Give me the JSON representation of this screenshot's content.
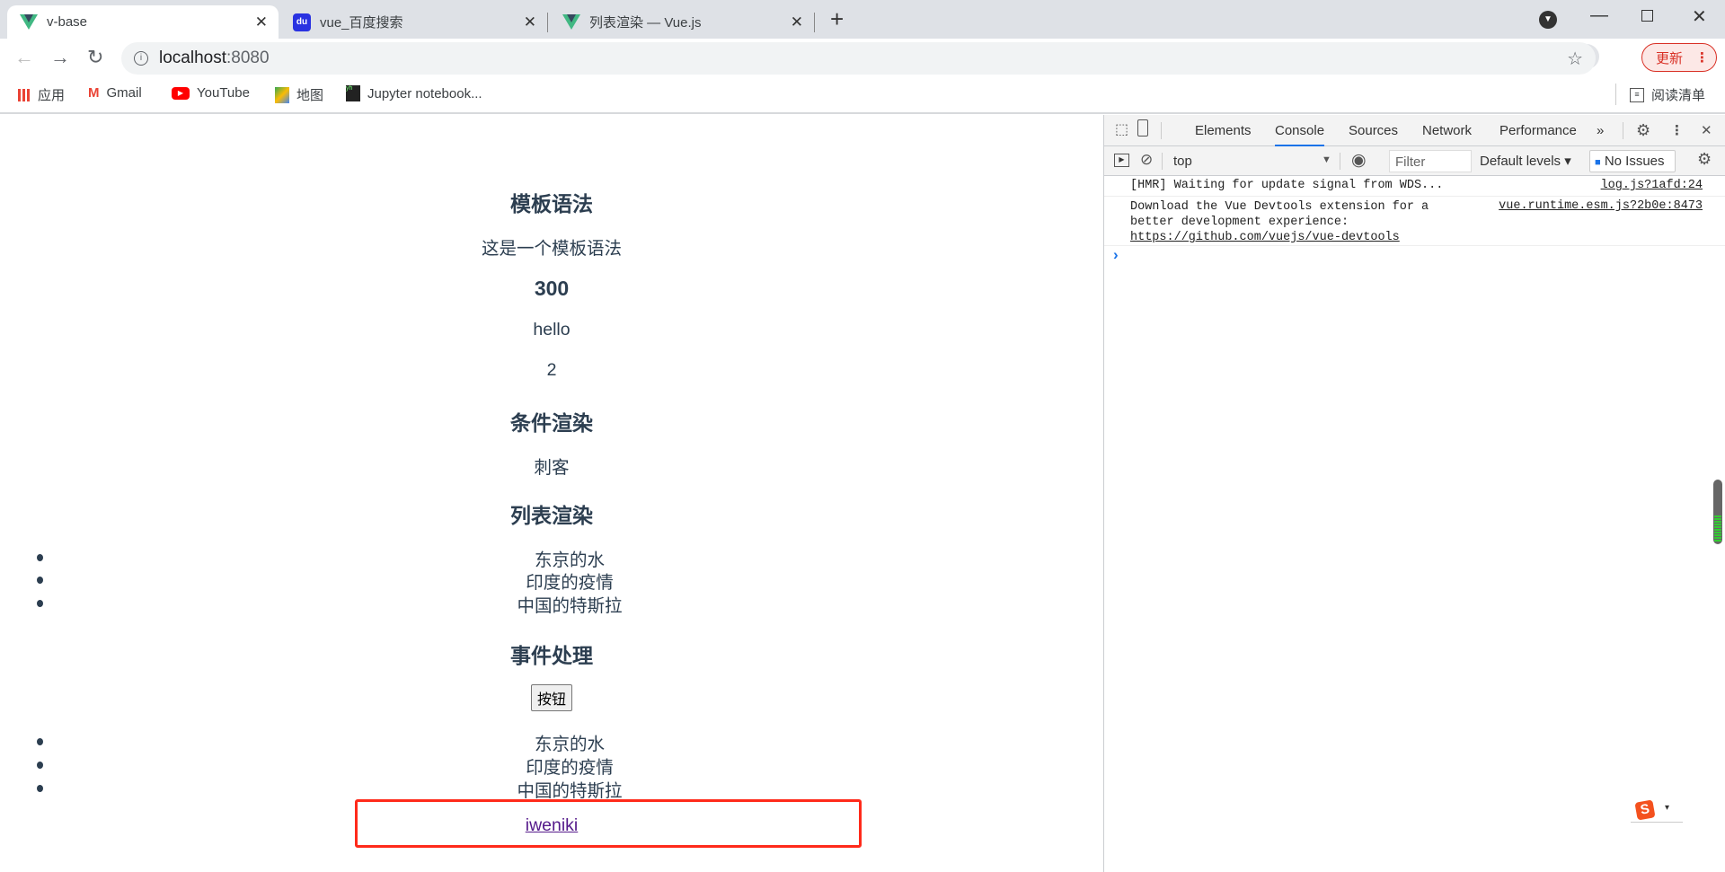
{
  "browser": {
    "tabs": [
      {
        "title": "v-base",
        "icon": "vue-logo-icon",
        "active": true
      },
      {
        "title": "vue_百度搜索",
        "icon": "baidu-paw-icon",
        "active": false
      },
      {
        "title": "列表渲染 — Vue.js",
        "icon": "vue-logo-icon",
        "active": false
      }
    ],
    "new_tab": "+",
    "address": {
      "host": "localhost",
      "port": ":8080"
    },
    "update_button": "更新",
    "bookmarks": [
      {
        "label": "应用",
        "icon": "apps-grid-icon"
      },
      {
        "label": "Gmail",
        "icon": "gmail-icon"
      },
      {
        "label": "YouTube",
        "icon": "youtube-icon"
      },
      {
        "label": "地图",
        "icon": "maps-icon"
      },
      {
        "label": "Jupyter notebook...",
        "icon": "jupyter-icon"
      }
    ],
    "reading_list": "阅读清单"
  },
  "page": {
    "template_heading": "模板语法",
    "template_text": "这是一个模板语法",
    "number_heading": "300",
    "hello": "hello",
    "two": "2",
    "conditional_heading": "条件渲染",
    "conditional_text": "刺客",
    "list_heading": "列表渲染",
    "list1": [
      "东京的水",
      "印度的疫情",
      "中国的特斯拉"
    ],
    "event_heading": "事件处理",
    "button_label": "按钮",
    "list2": [
      "东京的水",
      "印度的疫情",
      "中国的特斯拉"
    ],
    "link": "iweniki",
    "highlight_color": "#ff2a1a"
  },
  "devtools": {
    "tabs": [
      "Elements",
      "Console",
      "Sources",
      "Network",
      "Performance"
    ],
    "active_tab": "Console",
    "more": "»",
    "context": "top",
    "filter_placeholder": "Filter",
    "levels": "Default levels ▾",
    "issues": "No Issues",
    "messages": [
      {
        "text": "[HMR] Waiting for update signal from WDS...",
        "source": "log.js?1afd:24"
      },
      {
        "text": "Download the Vue Devtools extension for a better development experience:",
        "link": "https://github.com/vuejs/vue-devtools",
        "source": "vue.runtime.esm.js?2b0e:8473"
      }
    ],
    "prompt": "›"
  }
}
